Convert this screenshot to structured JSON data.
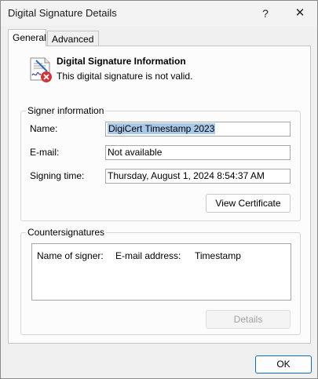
{
  "window": {
    "title": "Digital Signature Details",
    "help_glyph": "?",
    "close_glyph": "✕"
  },
  "tabs": [
    {
      "label": "General",
      "active": true
    },
    {
      "label": "Advanced",
      "active": false
    }
  ],
  "info": {
    "icon": "signature-invalid-icon",
    "title": "Digital Signature Information",
    "status": "This digital signature is not valid."
  },
  "signer": {
    "group_label": "Signer information",
    "name_label": "Name:",
    "name_value": "DigiCert Timestamp 2023",
    "email_label": "E-mail:",
    "email_value": "Not available",
    "time_label": "Signing time:",
    "time_value": "Thursday, August 1, 2024 8:54:37 AM",
    "view_cert_label": "View Certificate"
  },
  "countersignatures": {
    "group_label": "Countersignatures",
    "columns": [
      "Name of signer:",
      "E-mail address:",
      "Timestamp"
    ],
    "rows": [],
    "details_label": "Details"
  },
  "footer": {
    "ok_label": "OK"
  },
  "colors": {
    "accent": "#0f6cbd",
    "selection": "#a9c9ea",
    "error": "#d13438"
  }
}
